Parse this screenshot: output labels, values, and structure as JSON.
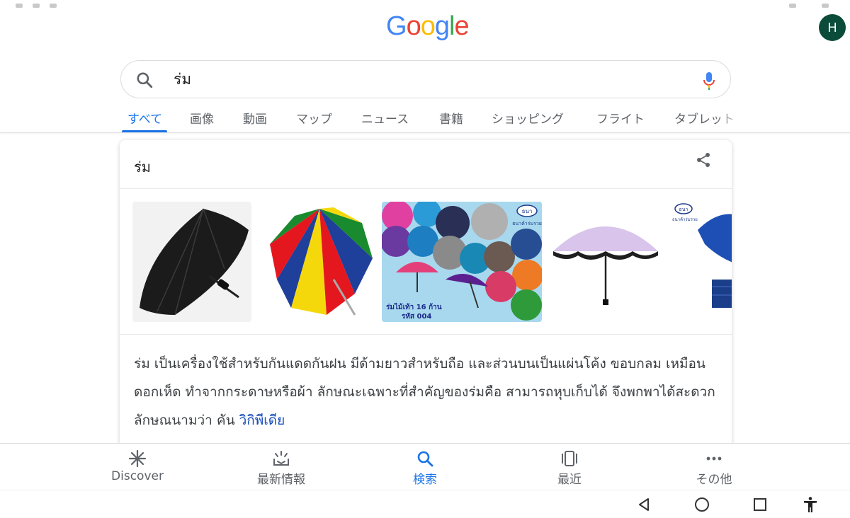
{
  "logo": {
    "letters": [
      "G",
      "o",
      "o",
      "g",
      "l",
      "e"
    ],
    "colors": [
      "#4285f4",
      "#ea4335",
      "#fbbc05",
      "#4285f4",
      "#34a853",
      "#ea4335"
    ]
  },
  "account": {
    "initial": "H",
    "color": "#0b4b3a"
  },
  "search": {
    "query": "ร่ม"
  },
  "tabs": [
    {
      "label": "すべて",
      "active": true
    },
    {
      "label": "画像"
    },
    {
      "label": "動画"
    },
    {
      "label": "マップ"
    },
    {
      "label": "ニュース"
    },
    {
      "label": "書籍"
    },
    {
      "label": "ショッピング"
    },
    {
      "label": "フライト"
    },
    {
      "label": "タブレット"
    }
  ],
  "knowledge_card": {
    "title": "ร่ม",
    "images": [
      {
        "alt": "black folding umbrella"
      },
      {
        "alt": "rainbow beach umbrella"
      },
      {
        "alt": "umbrella collage",
        "caption_line1": "ร่มไม้เท้า 16 ก้าน",
        "caption_line2": "รหัส 004",
        "brand": "ธนา",
        "brand_sub": "ธนาค้าร่มรวย"
      },
      {
        "alt": "lavender umbrella"
      },
      {
        "alt": "blue umbrella",
        "brand": "ธนา",
        "brand_sub": "ธนาค้าร่มรวย"
      }
    ],
    "description": "ร่ม เป็นเครื่องใช้สำหรับกันแดดกันฝน มีด้ามยาวสำหรับถือ และส่วนบนเป็นแผ่นโค้ง ขอบกลม เหมือนดอกเห็ด ทำจากกระดาษหรือผ้า ลักษณะเฉพาะที่สำคัญของร่มคือ สามารถหุบเก็บได้ จึงพกพาได้สะดวก ลักษณนามว่า คัน",
    "source_link": "วิกิพีเดีย"
  },
  "bottom_nav": [
    {
      "label": "Discover",
      "icon": "asterisk-icon"
    },
    {
      "label": "最新情報",
      "icon": "updates-icon"
    },
    {
      "label": "検索",
      "icon": "search-icon",
      "active": true
    },
    {
      "label": "最近",
      "icon": "recent-tabs-icon"
    },
    {
      "label": "その他",
      "icon": "more-dots-icon"
    }
  ],
  "system_nav": [
    "back-icon",
    "home-icon",
    "overview-icon",
    "accessibility-icon"
  ],
  "colors": {
    "accent": "#1a73e8",
    "link": "#1a4fba",
    "text": "#202124",
    "muted": "#5f6368"
  }
}
